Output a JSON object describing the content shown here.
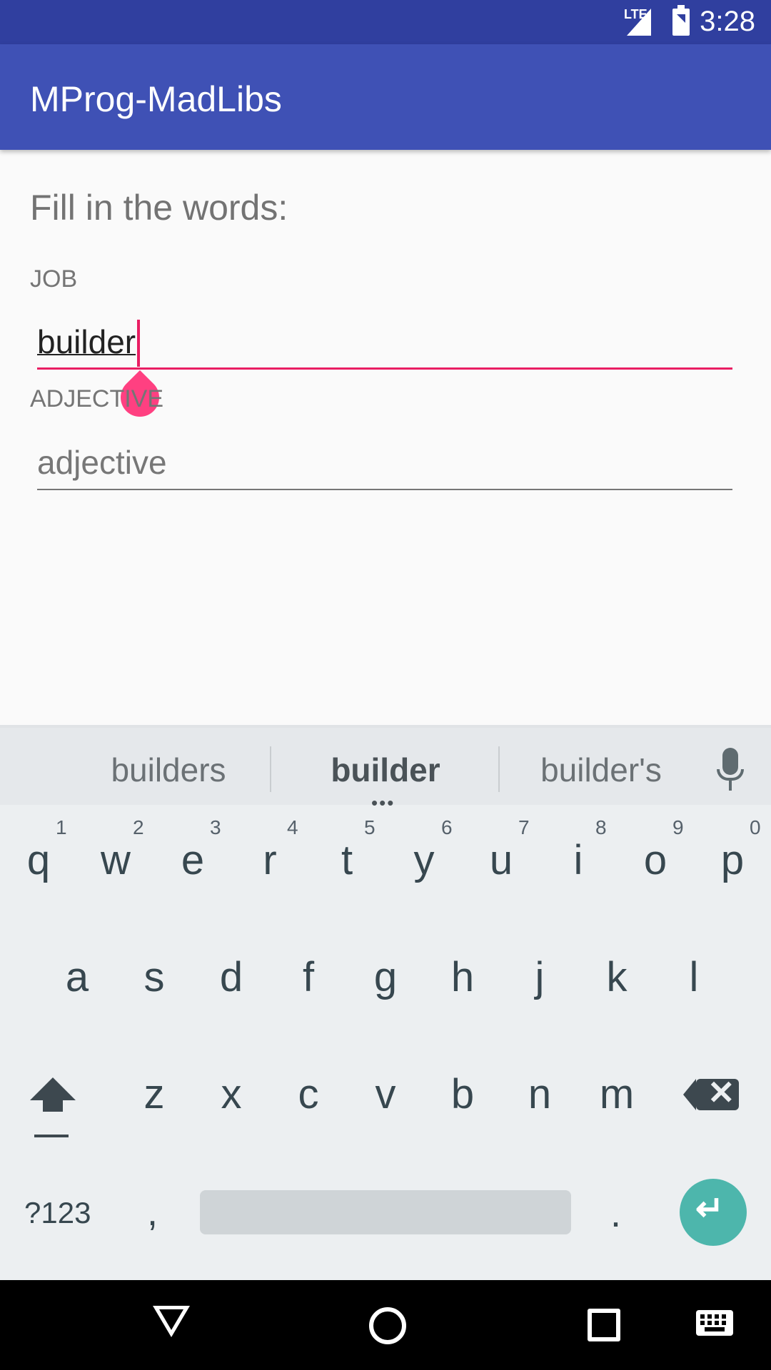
{
  "status_bar": {
    "network": "LTE",
    "time": "3:28"
  },
  "app_bar": {
    "title": "MProg-MadLibs"
  },
  "form": {
    "heading": "Fill in the words:",
    "job_label": "JOB",
    "job_value": "builder",
    "adjective_label": "ADJECTIVE",
    "adjective_placeholder": "adjective"
  },
  "keyboard": {
    "suggestions": [
      "builders",
      "builder",
      "builder's"
    ],
    "row1": [
      "q",
      "w",
      "e",
      "r",
      "t",
      "y",
      "u",
      "i",
      "o",
      "p"
    ],
    "row1_numbers": [
      "1",
      "2",
      "3",
      "4",
      "5",
      "6",
      "7",
      "8",
      "9",
      "0"
    ],
    "row2": [
      "a",
      "s",
      "d",
      "f",
      "g",
      "h",
      "j",
      "k",
      "l"
    ],
    "row3": [
      "z",
      "x",
      "c",
      "v",
      "b",
      "n",
      "m"
    ],
    "symbols_label": "?123",
    "comma": ",",
    "period": "."
  },
  "colors": {
    "status_bar": "#303f9f",
    "app_bar": "#3f51b5",
    "accent": "#e91e63",
    "enter_key": "#4db6ac"
  }
}
